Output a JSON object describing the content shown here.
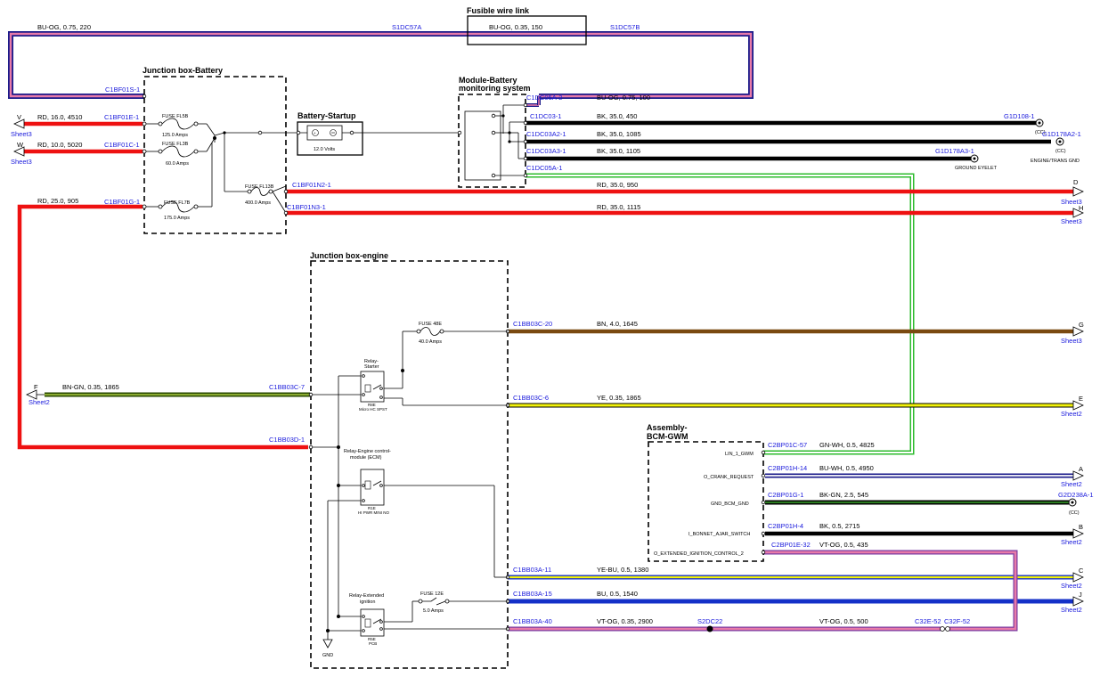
{
  "colors": {
    "red": "#ee1111",
    "black": "#000000",
    "brown": "#7a4a10",
    "yellow": "#f2f20a",
    "olive": "#5a6a14",
    "green_stripe": "#2dbb2d",
    "blue": "#1430c8",
    "navy": "#1a1a8a",
    "pink": "#e87aa8",
    "violet": "#7a3aa0",
    "label_blue": "#1a1adc"
  },
  "boxes": {
    "fusible": "Fusible wire link",
    "jb_battery": "Junction box-Battery",
    "battery_startup": "Battery-Startup",
    "module_bms_1": "Module-Battery",
    "module_bms_2": "monitoring system",
    "jb_engine": "Junction box-engine",
    "bcm_1": "Assembly-",
    "bcm_2": "BCM-GWM"
  },
  "top_wire": {
    "spec_left": "BU-OG, 0.75, 220",
    "splice_left": "S1DC57A",
    "spec_link": "BU-OG, 0.35, 150",
    "splice_right": "S1DC57B",
    "conn": "C1BF01S-1"
  },
  "battery_fuses": {
    "fl5b": {
      "name": "FUSE FL5B",
      "rating": "125.0 Amps"
    },
    "fl3b": {
      "name": "FUSE FL3B",
      "rating": "60.0 Amps"
    },
    "fl7b": {
      "name": "FUSE FL7B",
      "rating": "175.0 Amps"
    },
    "fl13b": {
      "name": "FUSE FL13B",
      "rating": "400.0 Amps"
    }
  },
  "battery_startup": {
    "volts": "12.0 Volts"
  },
  "left_wires": {
    "v": {
      "letter": "V",
      "sheet": "Sheet3",
      "spec": "RD, 16.0, 4510",
      "conn": "C1BF01E-1"
    },
    "w": {
      "letter": "W",
      "sheet": "Sheet3",
      "spec": "RD, 10.0, 5020",
      "conn": "C1BF01C-1"
    },
    "g1": {
      "spec": "RD, 25.0, 905",
      "conn": "C1BF01G-1"
    }
  },
  "right_wires": {
    "bms_top": {
      "conn": "C1DC05A-2",
      "spec": "BU-OG, 0.75, 100"
    },
    "gnd1": {
      "conn": "C1DC03-1",
      "spec": "BK, 35.0, 450",
      "end": "G1D108-1",
      "cc": "(CC)"
    },
    "gnd2": {
      "conn": "C1DC03A2-1",
      "spec": "BK, 35.0, 1085",
      "end": "G1D178A2-1",
      "cc": "(CC)",
      "end_label": "ENGINE/TRANS GND"
    },
    "gnd3": {
      "conn": "C1DC03A3-1",
      "spec": "BK, 35.0, 1105",
      "end": "G1D178A3-1",
      "end_label": "GROUND EYELET"
    },
    "lin": {
      "conn": "C1DC05A-1"
    },
    "d": {
      "conn": "C1BF01N2-1",
      "spec": "RD, 35.0, 950",
      "letter": "D",
      "sheet": "Sheet3"
    },
    "h": {
      "conn": "C1BF01N3-1",
      "spec": "RD, 35.0, 1115",
      "letter": "H",
      "sheet": "Sheet3"
    }
  },
  "engine": {
    "fuse48e": {
      "name": "FUSE 48E",
      "rating": "40.0 Amps"
    },
    "fuse12e": {
      "name": "FUSE 12E",
      "rating": "5.0 Amps"
    },
    "relay_starter": {
      "title1": "Relay-",
      "title2": "Starter",
      "code": "R8E",
      "sub": "Micro HC SPST"
    },
    "relay_ecm": {
      "title1": "Relay-Engine control-",
      "title2": "module (ECM)",
      "code": "R1E",
      "sub": "HI PWR MINI NO"
    },
    "relay_ext": {
      "title1": "Relay-Extended",
      "title2": "ignition",
      "code": "R5E",
      "sub": "PCB"
    },
    "gnd": "GND",
    "g": {
      "conn": "C1BB03C-20",
      "spec": "BN, 4.0, 1645",
      "letter": "G",
      "sheet": "Sheet3"
    },
    "f": {
      "conn": "C1BB03C-7",
      "spec": "BN-GN, 0.35, 1865",
      "letter": "F",
      "sheet": "Sheet2"
    },
    "e": {
      "conn": "C1BB03C-6",
      "spec": "YE, 0.35, 1865",
      "letter": "E",
      "sheet": "Sheet2"
    },
    "b3d": {
      "conn": "C1BB03D-1"
    },
    "c": {
      "conn": "C1BB03A-11",
      "spec": "YE-BU, 0.5, 1380",
      "letter": "C",
      "sheet": "Sheet2"
    },
    "j": {
      "conn": "C1BB03A-15",
      "spec": "BU, 0.5, 1540",
      "letter": "J",
      "sheet": "Sheet2"
    },
    "vt": {
      "conn": "C1BB03A-40",
      "spec": "VT-OG, 0.35, 2900",
      "splice": "S2DC22",
      "spec2": "VT-OG, 0.5, 500",
      "c32e": "C32E-52",
      "c32f": "C32F-52"
    }
  },
  "bcm": {
    "lin": {
      "label": "LIN_1_GWM",
      "conn": "C2BP01C-57",
      "spec": "GN-WH, 0.5, 4825"
    },
    "crank": {
      "label": "O_CRANK_REQUEST",
      "conn": "C2BP01H-14",
      "spec": "BU-WH, 0.5, 4950",
      "letter": "A",
      "sheet": "Sheet2"
    },
    "gnd": {
      "label": "GND_BCM_GND",
      "conn": "C2BP01G-1",
      "spec": "BK-GN, 2.5, 545",
      "end": "G2D238A-1",
      "cc": "(CC)"
    },
    "bonnet": {
      "label": "I_BONNET_AJAR_SWITCH",
      "conn": "C2BP01H-4",
      "spec": "BK, 0.5, 2715",
      "letter": "B",
      "sheet": "Sheet2"
    },
    "ext": {
      "label": "O_EXTENDED_IGNITION_CONTROL_2",
      "conn": "C2BP01E-32",
      "spec": "VT-OG, 0.5, 435"
    }
  }
}
